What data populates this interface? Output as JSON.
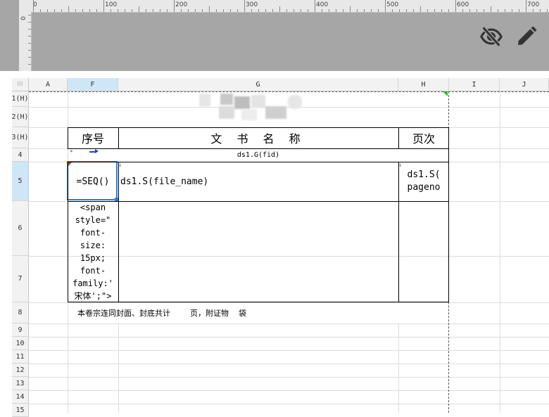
{
  "ruler": {
    "h_labels": [
      "0",
      "100",
      "200",
      "300",
      "400",
      "500",
      "600",
      "700"
    ],
    "v_label": "0"
  },
  "toolbar": {
    "hide_icon": "eye-off-icon",
    "edit_icon": "pencil-icon"
  },
  "columns": [
    "A",
    "F",
    "G",
    "H",
    "I",
    "J"
  ],
  "selected_column": "F",
  "rows": [
    "1(H)",
    "2(H)",
    "3(H)",
    "4",
    "5",
    "6",
    "7",
    "8",
    "9",
    "10",
    "11",
    "12",
    "13",
    "14",
    "15"
  ],
  "selected_row": "5",
  "cells": {
    "header_seq": "序号",
    "header_name": "文 书 名 称",
    "header_page": "页次",
    "row4_g": "ds1.G(fid)",
    "row5_f": "=SEQ()",
    "row5_g": "ds1.S(file_name)",
    "row5_h": "ds1.S(\npageno",
    "row67_f": "<span\nstyle=\"\nfont-\nsize:\n15px;\nfont-\nfamily:'\n宋体';\">",
    "row8": "本卷宗连同封面、封底共计        页，附证物    袋"
  },
  "colors": {
    "selection": "#2f7fd6",
    "ruler_bg": "#e8e8e8",
    "top_bg": "#a6a6a6"
  }
}
